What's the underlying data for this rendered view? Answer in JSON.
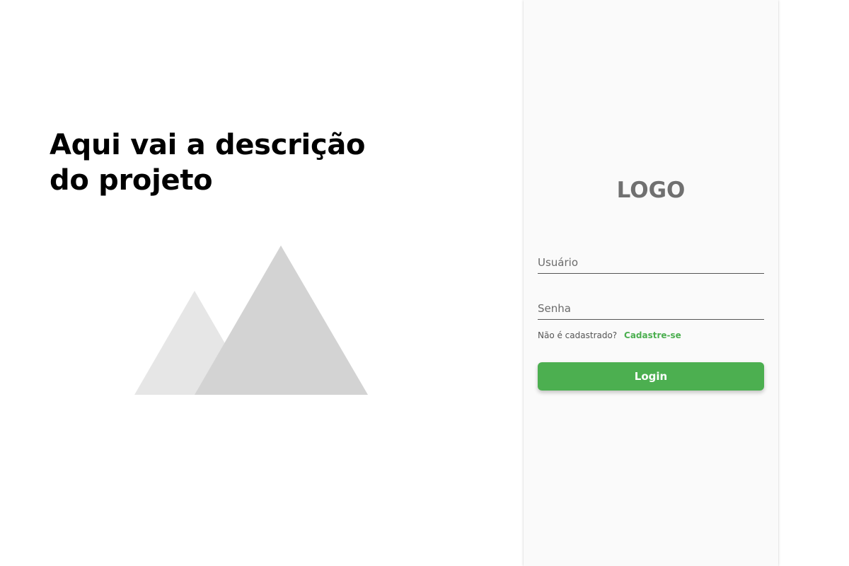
{
  "hero": {
    "title": "Aqui vai a descrição do projeto",
    "illustration_icon": "mountains-placeholder-icon"
  },
  "login": {
    "logo": "LOGO",
    "username": {
      "value": "",
      "placeholder": "Usuário"
    },
    "password": {
      "value": "",
      "placeholder": "Senha"
    },
    "signup_question": "Não é cadastrado?",
    "signup_link": "Cadastre-se",
    "login_button": "Login"
  },
  "colors": {
    "accent": "#4caf50",
    "panel_background": "#fafafa",
    "logo_text": "#707070",
    "illustration_light": "#e6e6e6",
    "illustration_dark": "#d3d3d3"
  }
}
